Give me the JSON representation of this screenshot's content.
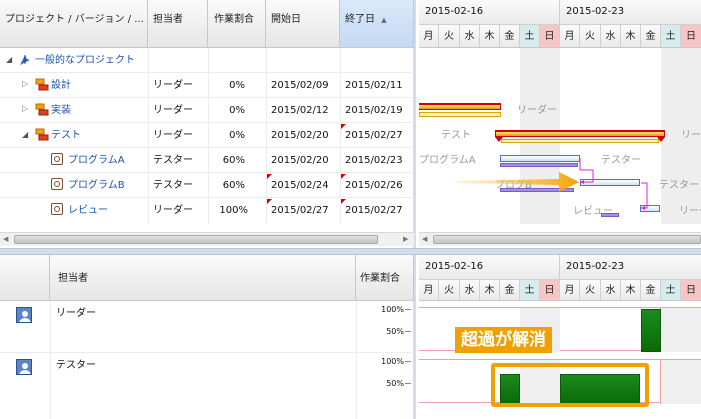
{
  "task_grid": {
    "columns": [
      "プロジェクト / バージョン / ...",
      "担当者",
      "作業割合",
      "開始日",
      "終了日"
    ],
    "sort_indicator": "▲",
    "rows": [
      {
        "name": "一般的なプロジェクト",
        "assignee": "",
        "ratio": "",
        "start": "",
        "end": ""
      },
      {
        "name": "設計",
        "assignee": "リーダー",
        "ratio": "0%",
        "start": "2015/02/09",
        "end": "2015/02/11"
      },
      {
        "name": "実装",
        "assignee": "リーダー",
        "ratio": "0%",
        "start": "2015/02/12",
        "end": "2015/02/19"
      },
      {
        "name": "テスト",
        "assignee": "リーダー",
        "ratio": "0%",
        "start": "2015/02/20",
        "end": "2015/02/27"
      },
      {
        "name": "プログラムA",
        "assignee": "テスター",
        "ratio": "60%",
        "start": "2015/02/20",
        "end": "2015/02/23"
      },
      {
        "name": "プログラムB",
        "assignee": "テスター",
        "ratio": "60%",
        "start": "2015/02/24",
        "end": "2015/02/26"
      },
      {
        "name": "レビュー",
        "assignee": "リーダー",
        "ratio": "100%",
        "start": "2015/02/27",
        "end": "2015/02/27"
      }
    ]
  },
  "timeline": {
    "weeks": [
      "2015-02-16",
      "2015-02-23"
    ],
    "days": [
      "月",
      "火",
      "水",
      "木",
      "金",
      "土",
      "日",
      "月",
      "火",
      "水",
      "木",
      "金",
      "土",
      "日"
    ]
  },
  "gantt_labels": {
    "jisso_assignee": "リーダー",
    "test_name": "テスト",
    "test_assignee": "リーダ",
    "progA_name": "プログラムA",
    "progA_assignee": "テスター",
    "progB_name": "プログB",
    "progB_assignee": "テスター",
    "review_name": "レビュー",
    "review_assignee": "リーダ"
  },
  "resource_grid": {
    "columns": [
      "担当者",
      "作業割合"
    ],
    "rows": [
      {
        "name": "リーダー",
        "levels": [
          "100%",
          "50%"
        ]
      },
      {
        "name": "テスター",
        "levels": [
          "100%",
          "50%"
        ]
      }
    ]
  },
  "callout": {
    "text": "超過が解消",
    "color": "#f0a000"
  },
  "colors": {
    "bar_red": "#d00000",
    "bar_blue": "#4a78b5",
    "arrow_orange": "#f5a000",
    "link_magenta": "#e020e0",
    "load_green": "#128012"
  }
}
